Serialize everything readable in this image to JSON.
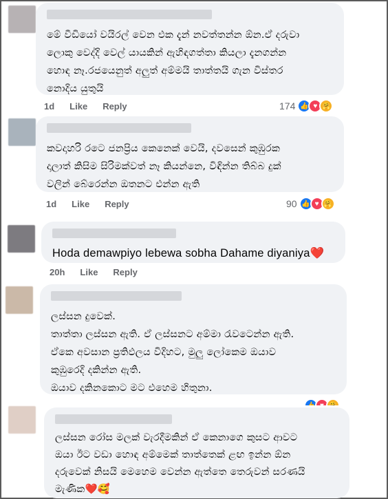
{
  "comments": [
    {
      "text": "මේ වීඩියෝ වයිරල් වෙන එක දැන් නවත්තන්න ඕන.ඒ දරුවා\nලොකු වෙද්දි වෙල් යායකින් ඇහිඳගත්තා කියලා දැනගන්න\nහොඳ නෑ.රජයෙනුත් අලුත් අම්මයි තාත්තයි ගැන විස්තර\nනොදිය යුතුයි",
      "time": "1d",
      "like": "Like",
      "reply": "Reply",
      "reaction_count": "174",
      "avatar_color": "#b7b2b4"
    },
    {
      "text": "කවදාහරි රටෙ ජනප්‍රිය කෙනෙක් වෙයි, දවසෙන් කුඹුරක\nදාලාත් කිසිම සිරිමක්වත් නෑ කියන්නෙ, විඳින්න තිබ්බ දුක්\nවලින් බේරෙන්න ඔතනට එන්න ඇති",
      "time": "1d",
      "like": "Like",
      "reply": "Reply",
      "reaction_count": "90",
      "avatar_color": "#a9b3bc"
    },
    {
      "text": "Hoda demawpiyo lebewa sobha Dahame diyaniya",
      "heart": "❤️",
      "time": "20h",
      "like": "Like",
      "reply": "Reply",
      "avatar_color": "#7d7b80"
    },
    {
      "text": "ලස්සන දුවෙක්.\nතාත්තා ලස්සන ඇති. ඒ ලස්සනට අම්මා රැවටෙන්න ඇති.\nඒකෙ අවසාන ප්‍රතිඵලය විදිහට, මුලු ලෝකෙම ඔයාව\nකුඹුරෙදි දකින්න ඇති.\nඔයාව දකිනකොට මට එහෙම හිතුනා.",
      "avatar_color": "#cbb9a8"
    },
    {
      "text": "ලස්සන රෝස මලක් වැරදීමකින් ඒ කෙනාගෙ කුසට ආවට\nඔයා ඊට වඩා හොඳ අම්මෙක් තාත්තෙක් ළඟ ඉන්න ඕන\nදරුවෙක් නිසයි මෙහෙම වෙන්න ඇත්තෙ තෙරුවන් සරණයි\nමැණික",
      "emojis": "❤️🥰",
      "avatar_color": "#e0cfc6"
    }
  ],
  "icons": {
    "like": "👍",
    "love": "♥",
    "care": "🤗"
  }
}
